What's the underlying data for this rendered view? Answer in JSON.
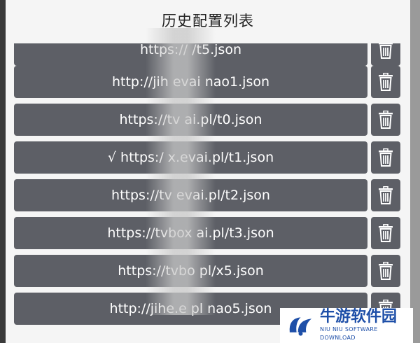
{
  "dialog": {
    "title": "历史配置列表"
  },
  "history": {
    "items": [
      {
        "url": "https://               /t5.json",
        "selected": false
      },
      {
        "url": "http://jih     evai     nao1.json",
        "selected": false
      },
      {
        "url": "https://tv        ai.pl/t0.json",
        "selected": false
      },
      {
        "url": "√ https:/      x.evai.pl/t1.json",
        "selected": true
      },
      {
        "url": "https://tv       evai.pl/t2.json",
        "selected": false
      },
      {
        "url": "https://tvbox      ai.pl/t3.json",
        "selected": false
      },
      {
        "url": "https://tvbo         pl/x5.json",
        "selected": false
      },
      {
        "url": "http://jihe.e       pl  nao5.json",
        "selected": false
      }
    ],
    "delete_icon": "trash-icon"
  },
  "watermark": {
    "cn": "牛游软件园",
    "en": "NIU NIU SOFTWARE DOWNLOAD"
  }
}
